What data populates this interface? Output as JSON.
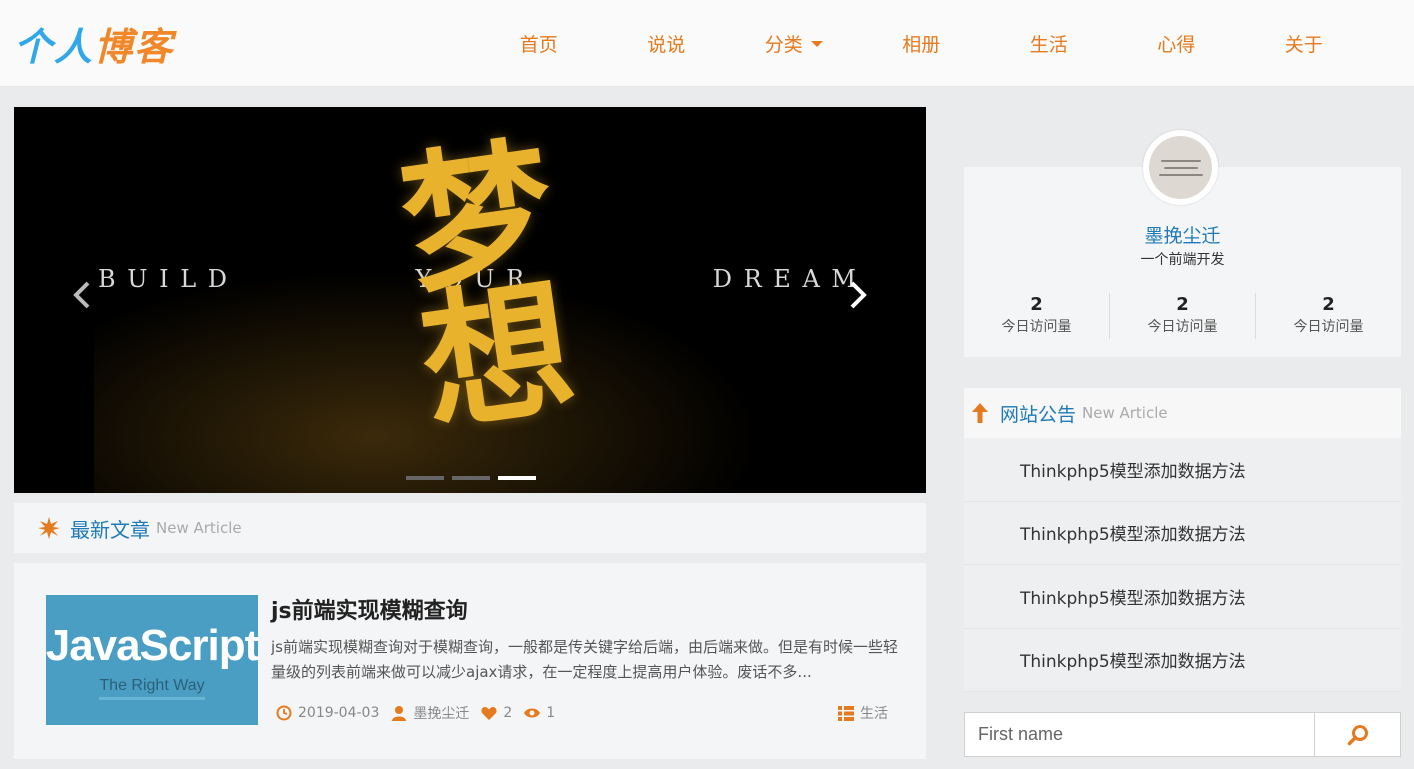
{
  "header": {
    "logo_chars": [
      "个",
      "人",
      "博",
      "客"
    ],
    "nav": [
      "首页",
      "说说",
      "分类",
      "相册",
      "生活",
      "心得",
      "关于"
    ]
  },
  "banner": {
    "words": [
      "B U I L D",
      "Y O U R",
      "D R E A M"
    ],
    "calligraphy": "梦想",
    "slide_count": 3,
    "active_slide": 3
  },
  "latest": {
    "title": "最新文章",
    "sub": "New Article"
  },
  "article": {
    "thumb_title": "JavaScript",
    "thumb_sub": "The Right Way",
    "title": "js前端实现模糊查询",
    "excerpt": "js前端实现模糊查询对于模糊查询，一般都是传关键字给后端，由后端来做。但是有时候一些轻量级的列表前端来做可以减少ajax请求，在一定程度上提高用户体验。废话不多...",
    "date": "2019-04-03",
    "author": "墨挽尘迁",
    "likes": "2",
    "views": "1",
    "category": "生活"
  },
  "profile": {
    "name": "墨挽尘迁",
    "desc": "一个前端开发",
    "stats": [
      {
        "num": "2",
        "label": "今日访问量"
      },
      {
        "num": "2",
        "label": "今日访问量"
      },
      {
        "num": "2",
        "label": "今日访问量"
      }
    ]
  },
  "notice": {
    "title": "网站公告",
    "sub": "New Article",
    "items": [
      "Thinkphp5模型添加数据方法",
      "Thinkphp5模型添加数据方法",
      "Thinkphp5模型添加数据方法",
      "Thinkphp5模型添加数据方法"
    ]
  },
  "search": {
    "placeholder": "First name"
  },
  "colors": {
    "accent_orange": "#e67a1e",
    "link_blue": "#1f7ab8",
    "banner_gold": "#e9b22d"
  },
  "icons": {
    "prev": "chevron-left-icon",
    "next": "chevron-right-icon",
    "latest": "starburst-icon",
    "notice": "arrow-up-icon",
    "date": "clock-icon",
    "author": "user-icon",
    "likes": "heart-icon",
    "views": "eye-icon",
    "category": "list-icon",
    "search": "search-icon"
  }
}
